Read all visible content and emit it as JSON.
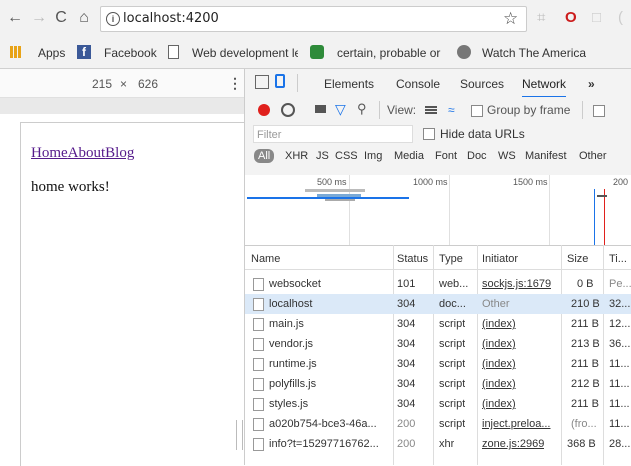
{
  "browser": {
    "url": "localhost:4200",
    "bookmarks": [
      {
        "label": "Apps",
        "icon": "apps-grid-icon"
      },
      {
        "label": "Facebook",
        "icon": "facebook-icon"
      },
      {
        "label": "Web development le",
        "icon": "page-icon"
      },
      {
        "label": "certain, probable or",
        "icon": "puzzle-icon"
      },
      {
        "label": "Watch The American",
        "icon": "globe-icon"
      }
    ]
  },
  "device": {
    "width": "215",
    "times": "×",
    "height": "626"
  },
  "app": {
    "nav_links": [
      "Home",
      "About",
      "Blog"
    ],
    "content": "home works!"
  },
  "devtools": {
    "tabs": [
      "Elements",
      "Console",
      "Sources",
      "Network"
    ],
    "active_tab": "Network",
    "more": "»",
    "view_label": "View:",
    "group_by_frame": "Group by frame",
    "filter_placeholder": "Filter",
    "hide_data_urls": "Hide data URLs",
    "types": [
      "All",
      "XHR",
      "JS",
      "CSS",
      "Img",
      "Media",
      "Font",
      "Doc",
      "WS",
      "Manifest",
      "Other"
    ],
    "timeline_ticks": [
      "500 ms",
      "1000 ms",
      "1500 ms",
      "200"
    ],
    "columns": [
      "Name",
      "Status",
      "Type",
      "Initiator",
      "Size",
      "Ti..."
    ],
    "rows": [
      {
        "name": "websocket",
        "status": "101",
        "type": "web...",
        "initiator": "sockjs.js:1679",
        "size": "0 B",
        "time": "Pe..."
      },
      {
        "name": "localhost",
        "status": "304",
        "type": "doc...",
        "initiator": "Other",
        "size": "210 B",
        "time": "32..."
      },
      {
        "name": "main.js",
        "status": "304",
        "type": "script",
        "initiator": "(index)",
        "size": "211 B",
        "time": "12..."
      },
      {
        "name": "vendor.js",
        "status": "304",
        "type": "script",
        "initiator": "(index)",
        "size": "213 B",
        "time": "36..."
      },
      {
        "name": "runtime.js",
        "status": "304",
        "type": "script",
        "initiator": "(index)",
        "size": "211 B",
        "time": "11..."
      },
      {
        "name": "polyfills.js",
        "status": "304",
        "type": "script",
        "initiator": "(index)",
        "size": "212 B",
        "time": "11..."
      },
      {
        "name": "styles.js",
        "status": "304",
        "type": "script",
        "initiator": "(index)",
        "size": "211 B",
        "time": "11..."
      },
      {
        "name": "a020b754-bce3-46a...",
        "status": "200",
        "type": "script",
        "initiator": "inject.preloa...",
        "size": "(fro...",
        "time": "11..."
      },
      {
        "name": "info?t=15297716762...",
        "status": "200",
        "type": "xhr",
        "initiator": "zone.js:2969",
        "size": "368 B",
        "time": "28..."
      }
    ]
  },
  "colors": {
    "record": "#e0201c",
    "selected_row": "#dbe9f8",
    "link": "#551a8b",
    "accent": "#1a73e8"
  }
}
